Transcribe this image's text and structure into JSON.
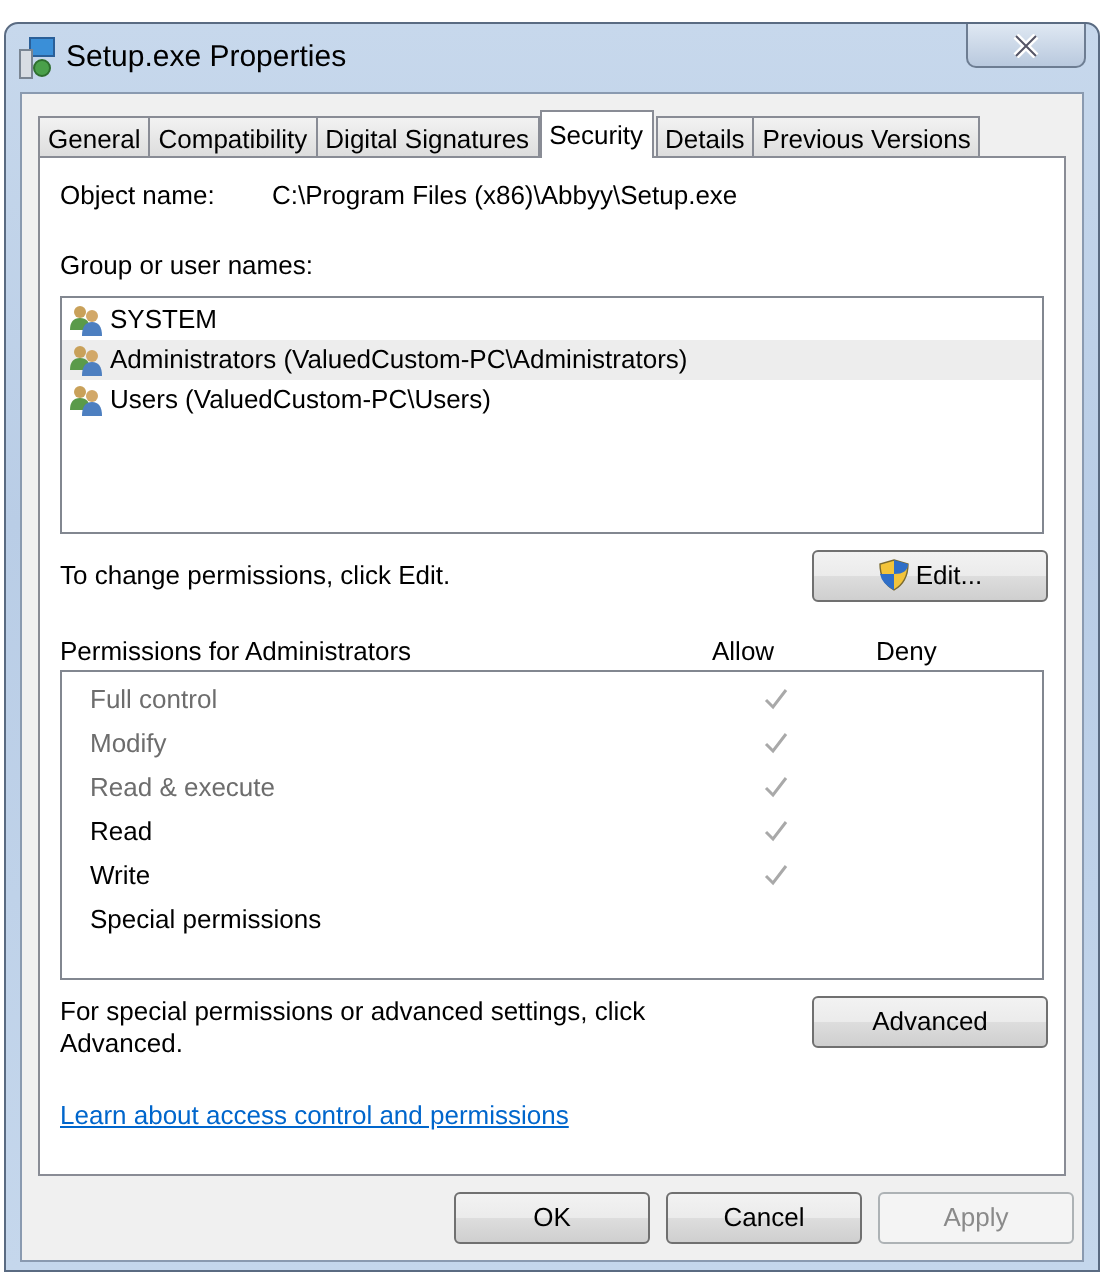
{
  "window": {
    "title": "Setup.exe Properties"
  },
  "tabs": [
    {
      "label": "General",
      "selected": false
    },
    {
      "label": "Compatibility",
      "selected": false
    },
    {
      "label": "Digital Signatures",
      "selected": false
    },
    {
      "label": "Security",
      "selected": true
    },
    {
      "label": "Details",
      "selected": false
    },
    {
      "label": "Previous Versions",
      "selected": false
    }
  ],
  "object_name": {
    "label": "Object name:",
    "value": "C:\\Program Files (x86)\\Abbyy\\Setup.exe"
  },
  "groups": {
    "label": "Group or user names:",
    "items": [
      {
        "name": "SYSTEM",
        "selected": false
      },
      {
        "name": "Administrators (ValuedCustom-PC\\Administrators)",
        "selected": true
      },
      {
        "name": "Users (ValuedCustom-PC\\Users)",
        "selected": false
      }
    ]
  },
  "change_hint": "To change permissions, click Edit.",
  "edit_button": "Edit...",
  "permissions": {
    "title": "Permissions for Administrators",
    "allow_header": "Allow",
    "deny_header": "Deny",
    "rows": [
      {
        "name": "Full control",
        "disabled": true,
        "allow": true,
        "deny": false
      },
      {
        "name": "Modify",
        "disabled": true,
        "allow": true,
        "deny": false
      },
      {
        "name": "Read & execute",
        "disabled": true,
        "allow": true,
        "deny": false
      },
      {
        "name": "Read",
        "disabled": false,
        "allow": true,
        "deny": false
      },
      {
        "name": "Write",
        "disabled": false,
        "allow": true,
        "deny": false
      },
      {
        "name": "Special permissions",
        "disabled": false,
        "allow": false,
        "deny": false
      }
    ]
  },
  "advanced_hint": "For special permissions or advanced settings, click Advanced.",
  "advanced_button": "Advanced",
  "help_link": "Learn about access control and permissions",
  "buttons": [
    {
      "label": "OK",
      "disabled": false
    },
    {
      "label": "Cancel",
      "disabled": false
    },
    {
      "label": "Apply",
      "disabled": true
    }
  ]
}
